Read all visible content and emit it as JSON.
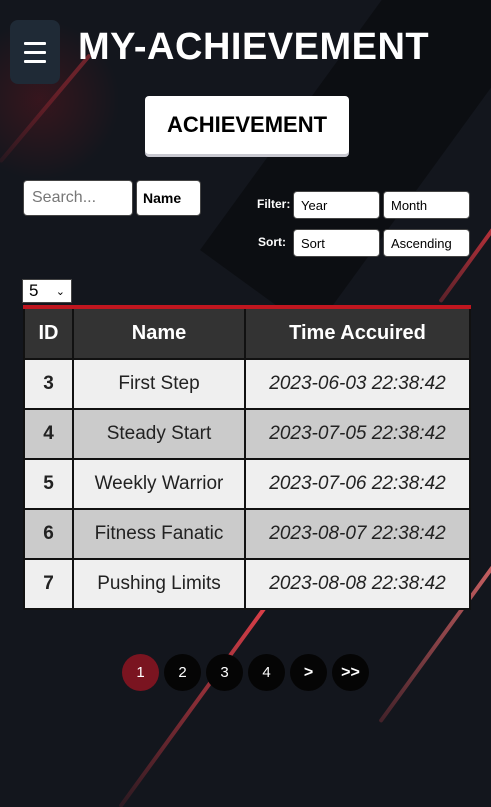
{
  "app": {
    "title": "MY-ACHIEVEMENT"
  },
  "section": {
    "button_label": "ACHIEVEMENT"
  },
  "search": {
    "placeholder": "Search...",
    "field": "Name"
  },
  "filter": {
    "label": "Filter:",
    "year": "Year",
    "month": "Month"
  },
  "sort": {
    "label": "Sort:",
    "field": "Sort",
    "order": "Ascending"
  },
  "page_size": {
    "value": "5"
  },
  "table": {
    "headers": {
      "id": "ID",
      "name": "Name",
      "time": "Time Accuired"
    },
    "rows": [
      {
        "id": "3",
        "name": "First Step",
        "time": "2023-06-03 22:38:42"
      },
      {
        "id": "4",
        "name": "Steady Start",
        "time": "2023-07-05 22:38:42"
      },
      {
        "id": "5",
        "name": "Weekly Warrior",
        "time": "2023-07-06 22:38:42"
      },
      {
        "id": "6",
        "name": "Fitness Fanatic",
        "time": "2023-08-07 22:38:42"
      },
      {
        "id": "7",
        "name": "Pushing Limits",
        "time": "2023-08-08 22:38:42"
      }
    ]
  },
  "pagination": {
    "pages": [
      "1",
      "2",
      "3",
      "4"
    ],
    "current": "1",
    "next": ">",
    "last": ">>"
  },
  "colors": {
    "background": "#13161d",
    "accent_red": "#c0161f",
    "active_page": "#7a1420",
    "header_bg": "#333333"
  }
}
